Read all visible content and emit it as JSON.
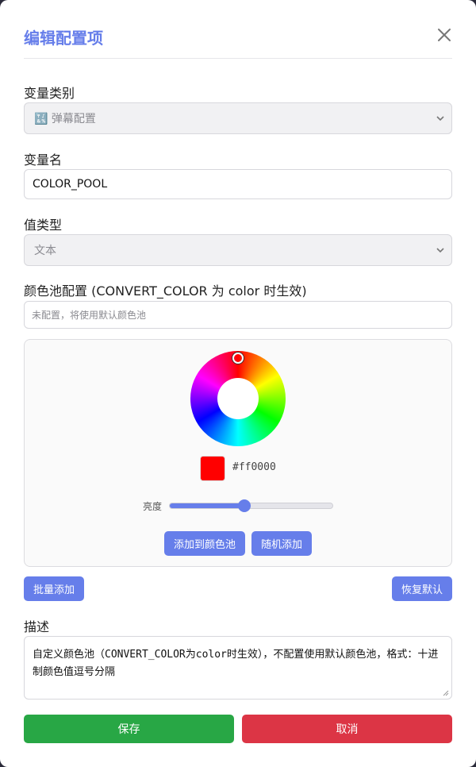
{
  "modal": {
    "title": "编辑配置项",
    "close_icon": "close-icon"
  },
  "category": {
    "label": "变量类别",
    "value": "🔣 弹幕配置"
  },
  "name": {
    "label": "变量名",
    "value": "COLOR_POOL"
  },
  "value_type": {
    "label": "值类型",
    "value": "文本"
  },
  "color_pool": {
    "label": "颜色池配置 (CONVERT_COLOR 为 color 时生效)",
    "placeholder": "未配置，将使用默认颜色池"
  },
  "picker": {
    "selected_color": "#ff0000",
    "hex_text": "#ff0000",
    "brightness_label": "亮度",
    "brightness_fraction": 0.46,
    "add_button": "添加到颜色池",
    "random_button": "随机添加"
  },
  "actions": {
    "batch_add": "批量添加",
    "restore_default": "恢复默认"
  },
  "description": {
    "label": "描述",
    "value": "自定义颜色池（CONVERT_COLOR为color时生效），不配置使用默认颜色池，格式：十进制颜色值逗号分隔"
  },
  "footer": {
    "save": "保存",
    "cancel": "取消"
  },
  "colors": {
    "accent": "#667eea",
    "save": "#28a745",
    "cancel": "#dc3545"
  }
}
